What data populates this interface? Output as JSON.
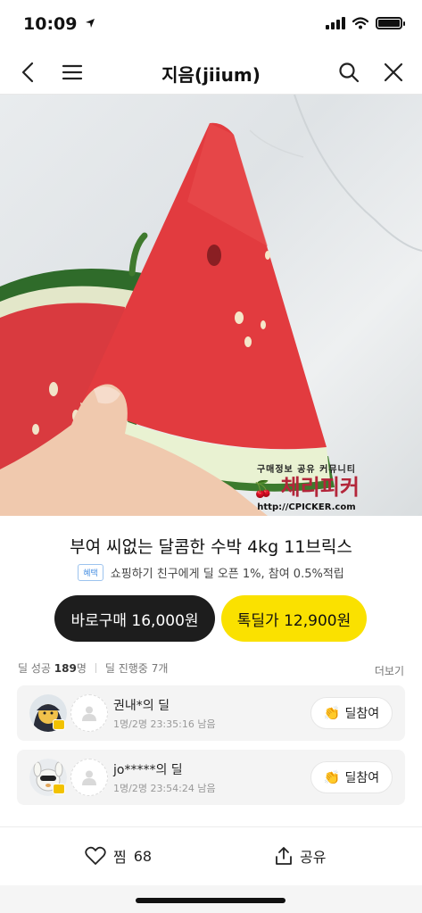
{
  "status": {
    "time": "10:09"
  },
  "nav": {
    "title": "지음(jiium)"
  },
  "watermark": {
    "tagline": "구매정보 공유 커뮤니티",
    "brand": "체리피커",
    "url": "http://CPICKER.com"
  },
  "product": {
    "title": "부여 씨없는 달콤한 수박 4kg 11브릭스",
    "benefit_tag": "혜택",
    "benefit_text": "쇼핑하기 친구에게 딜 오픈 1%, 참여 0.5%적립"
  },
  "buttons": {
    "buy_now": "바로구매 16,000원",
    "talk_deal": "톡딜가 12,900원"
  },
  "stats": {
    "success_label": "딜 성공",
    "success_count": "189",
    "success_unit": "명",
    "ongoing_label": "딜 진행중",
    "ongoing_count": "7개",
    "more": "더보기"
  },
  "deals": [
    {
      "name": "권내*의 딜",
      "meta": "1명/2명  23:35:16 남음",
      "join_label": "딜참여"
    },
    {
      "name": "jo*****의 딜",
      "meta": "1명/2명  23:54:24 남음",
      "join_label": "딜참여"
    }
  ],
  "bottom": {
    "like_label": "찜",
    "like_count": "68",
    "share_label": "공유"
  },
  "colors": {
    "talk_yellow": "#fae100",
    "dark": "#1d1d1d",
    "watermark_red": "#b3263a"
  }
}
